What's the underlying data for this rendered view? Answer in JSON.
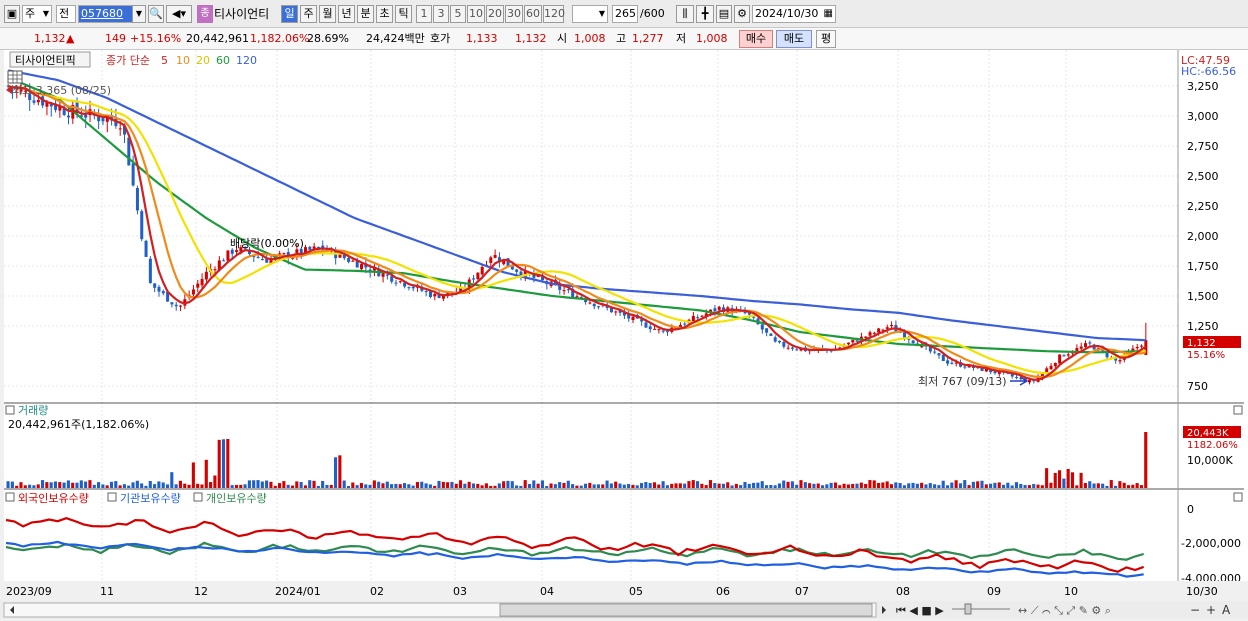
{
  "toolbar": {
    "market_type": "주",
    "prev_label": "전",
    "stock_code": "057680",
    "stock_name": "티사이언티",
    "stock_badge": "종",
    "periods": [
      "일",
      "주",
      "월",
      "년",
      "분",
      "초",
      "틱"
    ],
    "period_selected": "일",
    "intervals": [
      "1",
      "3",
      "5",
      "10",
      "20",
      "30",
      "60",
      "120"
    ],
    "count": "265",
    "count_total": "/600",
    "date": "2024/10/30"
  },
  "quote": {
    "price": "1,132",
    "change_arrow": "▲",
    "change": "149",
    "change_pct": "+15.16%",
    "volume": "20,442,961",
    "volume_pct": "1,182.06%",
    "turnover": "28.69%",
    "amount": "24,424백만",
    "bid_label": "호가",
    "bid1": "1,133",
    "bid2": "1,132",
    "open_label": "시",
    "open": "1,008",
    "high_label": "고",
    "high": "1,277",
    "low_label": "저",
    "low": "1,008",
    "buy_label": "매수",
    "sell_label": "매도",
    "eval_label": "평"
  },
  "price_panel": {
    "title": "티사이언티픽",
    "ma_label": "종가 단순",
    "ma_periods": [
      "5",
      "10",
      "20",
      "60",
      "120"
    ],
    "lc": "LC:47.59",
    "hc": "HC:-66.56",
    "high_note": "최고 3,365 (08/25)",
    "low_note": "최저 767 (09/13)",
    "dividend_note": "배당락(0.00%)",
    "current_price_tag": "1,132",
    "current_pct_tag": "15.16%",
    "y_ticks": [
      "3,250",
      "3,000",
      "2,750",
      "2,500",
      "2,250",
      "2,000",
      "1,750",
      "1,500",
      "1,250",
      "750"
    ]
  },
  "volume_panel": {
    "title": "거래량",
    "summary": "20,442,961주(1,182.06%)",
    "tag_value": "20,443K",
    "tag_pct": "1182.06%",
    "y_tick": "10,000K"
  },
  "holdings_panel": {
    "legend": [
      "외국인보유수량",
      "기관보유수량",
      "개인보유수량"
    ],
    "y_ticks": [
      "0",
      "-2,000,000",
      "-4,000,000"
    ]
  },
  "x_axis": {
    "labels": [
      "2023/09",
      "11",
      "12",
      "2024/01",
      "02",
      "03",
      "04",
      "05",
      "06",
      "07",
      "08",
      "09",
      "10",
      "10/30"
    ]
  },
  "colors": {
    "up": "#d40000",
    "down": "#1f5fc8",
    "ma5": "#d02020",
    "ma10": "#f08a1a",
    "ma20": "#f2e200",
    "ma60": "#1c9a3c",
    "ma120": "#3a5fd8",
    "foreign": "#d40000",
    "institution": "#1f5fe0",
    "individual": "#2e8a4e"
  },
  "chart_data": {
    "type": "candlestick",
    "y_range": [
      650,
      3400
    ],
    "dates": [
      "2023/09",
      "11",
      "12",
      "2024/01",
      "02",
      "03",
      "04",
      "05",
      "06",
      "07",
      "08",
      "09",
      "10",
      "10/30"
    ],
    "close_path": [
      3250,
      3150,
      3050,
      3000,
      2950,
      1600,
      1400,
      1700,
      1900,
      1800,
      1850,
      1900,
      1800,
      1700,
      1600,
      1500,
      1550,
      1850,
      1700,
      1600,
      1500,
      1400,
      1300,
      1200,
      1300,
      1400,
      1350,
      1100,
      1050,
      1050,
      1150,
      1250,
      1100,
      950,
      900,
      850,
      780,
      1000,
      1100,
      950,
      1132
    ],
    "ma120_path": [
      3380,
      3300,
      3150,
      2950,
      2750,
      2550,
      2350,
      2150,
      2000,
      1850,
      1700,
      1600,
      1560,
      1530,
      1500,
      1460,
      1430,
      1390,
      1360,
      1300,
      1250,
      1200,
      1150,
      1132
    ],
    "ma60_path": [
      3320,
      3150,
      2800,
      2450,
      2150,
      1900,
      1720,
      1710,
      1690,
      1620,
      1560,
      1500,
      1460,
      1420,
      1380,
      1300,
      1200,
      1150,
      1100,
      1080,
      1060,
      1040,
      1030,
      1040
    ],
    "current": {
      "price": 1132,
      "change": 149,
      "change_pct": 15.16,
      "volume": 20442961
    },
    "high": {
      "price": 3365,
      "date": "08/25"
    },
    "low": {
      "price": 767,
      "date": "09/13"
    }
  }
}
